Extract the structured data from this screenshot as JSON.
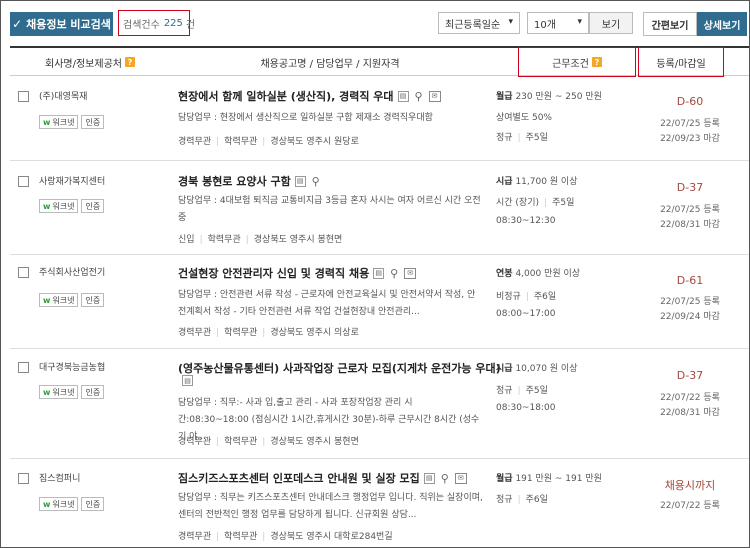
{
  "toolbar": {
    "compare_label": "채용정보 비교검색",
    "count_label": "검색건수",
    "count_value": "225",
    "count_unit": "건",
    "sort_selected": "최근등록일순",
    "size_selected": "10개",
    "view_label": "보기",
    "simple_view_label": "간편보기",
    "detail_view_label": "상세보기"
  },
  "header": {
    "company": "회사명/정보제공처",
    "title": "채용공고명 / 담당업무 / 지원자격",
    "conditions": "근무조건",
    "dates": "등록/마감일"
  },
  "badges": {
    "worknet": "워크넷",
    "certified": "인증"
  },
  "rows": [
    {
      "company": "(주)대영목재",
      "title": "현장에서 함께 일하실분 (생산직), 경력직 우대",
      "duty": "담당업무 : 현장에서 생산직으로 일하실분 구함 제재소 경력직우대함",
      "tag1": "경력무관",
      "tag2": "학력무관",
      "tag3": "경상북도 영주시 원당로",
      "pay_type": "월급",
      "pay_value": "230 만원 ~ 250 만원",
      "cond1": "상여별도 50%",
      "cond2a": "정규",
      "cond2b": "주5일",
      "dday": "D-60",
      "reg": "22/07/25 등록",
      "close": "22/09/23 마감"
    },
    {
      "company": "사랑재가복지센터",
      "title": "경북 봉현로 요양사 구함",
      "duty": "담당업무 : 4대보험 퇴직금 교통비지급 3등급 혼자 사시는 여자 어르신 시간 오전중",
      "tag1": "신입",
      "tag2": "학력무관",
      "tag3": "경상북도 영주시 봉현면",
      "pay_type": "시급",
      "pay_value": "11,700 원 이상",
      "cond1a": "시간 (장기)",
      "cond1b": "주5일",
      "cond2": "08:30~12:30",
      "dday": "D-37",
      "reg": "22/07/25 등록",
      "close": "22/08/31 마감"
    },
    {
      "company": "주식회사산업전기",
      "title": "건설현장 안전관리자 신입 및 경력직 채용",
      "duty": "담당업무 : 안전관련 서류 작성 - 근로자에 안전교육실시 및 안전서약서 작성, 안전계획서 작성 - 기타 안전관련 서류 작업 건설현장내 안전관리...",
      "tag1": "경력무관",
      "tag2": "학력무관",
      "tag3": "경상북도 영주시 의상로",
      "pay_type": "연봉",
      "pay_value": "4,000 만원 이상",
      "cond1a": "비정규",
      "cond1b": "주6일",
      "cond2": "08:00~17:00",
      "dday": "D-61",
      "reg": "22/07/25 등록",
      "close": "22/09/24 마감"
    },
    {
      "company": "대구경북능금농협",
      "title": "(영주농산물유통센터) 사과작업장 근로자 모집(지게차 운전가능 우대)",
      "duty": "담당업무 : 직무:- 사과 입,출고 관리 - 사과 포장작업장 관리 시간:08:30~18:00 (점심시간 1시간,휴게시간 30분)-하루 근무시간 8시간 (성수기 야...",
      "tag1": "경력무관",
      "tag2": "학력무관",
      "tag3": "경상북도 영주시 봉현면",
      "pay_type": "시급",
      "pay_value": "10,070 원 이상",
      "cond1a": "정규",
      "cond1b": "주5일",
      "cond2": "08:30~18:00",
      "dday": "D-37",
      "reg": "22/07/22 등록",
      "close": "22/08/31 마감"
    },
    {
      "company": "짐스컴퍼니",
      "title": "짐스키즈스포츠센터 인포데스크 안내원 및 실장 모집",
      "duty": "담당업무 : 직무는 키즈스포츠센터 안내데스크 행정업무 입니다. 직위는 실장이며, 센터의 전반적인 행정 업무를 담당하게 됩니다. 신규회원 상담...",
      "tag1": "경력무관",
      "tag2": "학력무관",
      "tag3": "경상북도 영주시 대학로284번길",
      "pay_type": "월급",
      "pay_value": "191 만원 ~ 191 만원",
      "cond1a": "정규",
      "cond1b": "주6일",
      "dday": "채용시까지",
      "reg": "22/07/22 등록"
    }
  ],
  "colors": {
    "accent": "#2f6c8f",
    "highlight_border": "#d0021b",
    "dday": "#a34a3a",
    "worknet": "#2e9b3a"
  }
}
